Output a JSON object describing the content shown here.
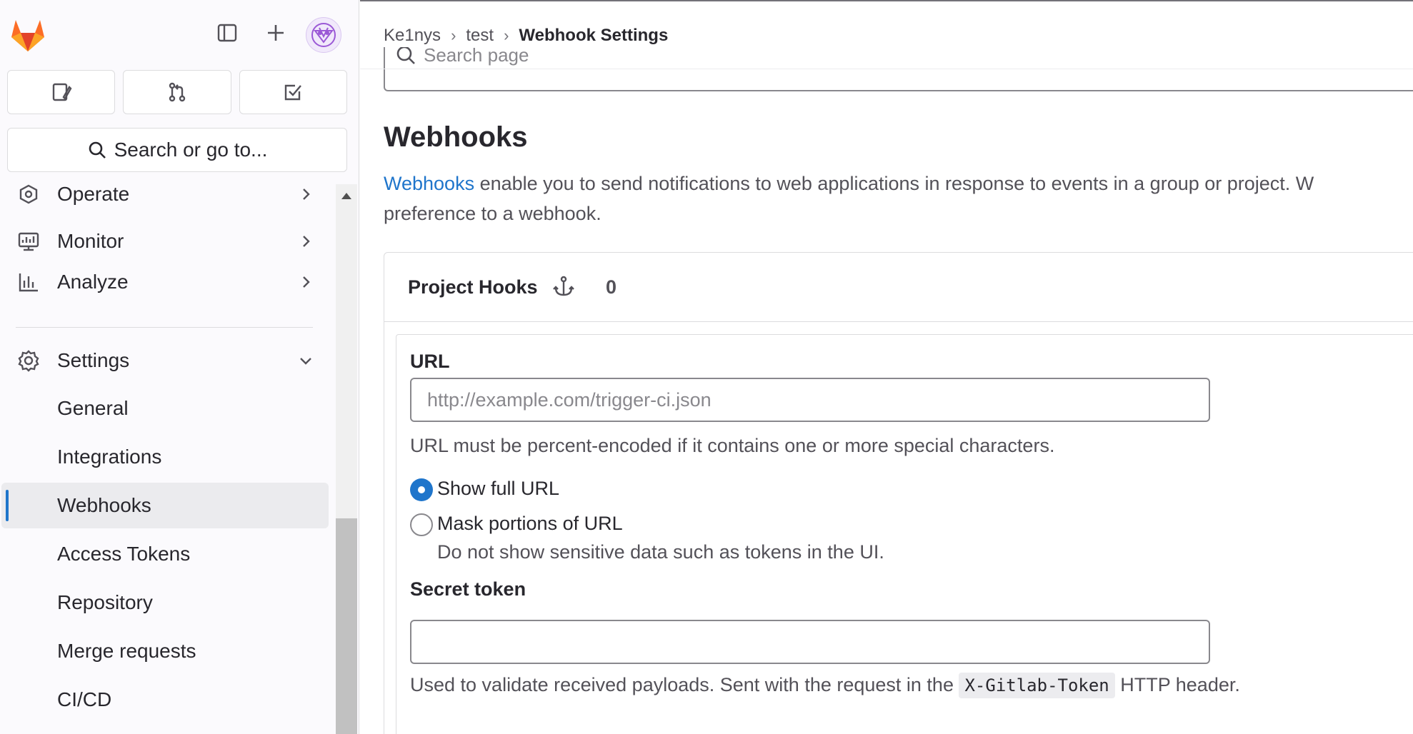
{
  "sidebar": {
    "search_label": "Search or go to...",
    "nav": [
      {
        "label": "Operate"
      },
      {
        "label": "Monitor"
      },
      {
        "label": "Analyze"
      },
      {
        "label": "Settings"
      }
    ],
    "settings_items": [
      {
        "label": "General"
      },
      {
        "label": "Integrations"
      },
      {
        "label": "Webhooks"
      },
      {
        "label": "Access Tokens"
      },
      {
        "label": "Repository"
      },
      {
        "label": "Merge requests"
      },
      {
        "label": "CI/CD"
      }
    ]
  },
  "breadcrumb": {
    "items": [
      "Ke1nys",
      "test",
      "Webhook Settings"
    ]
  },
  "page_search": {
    "placeholder": "Search page"
  },
  "page": {
    "title": "Webhooks",
    "desc_link": "Webhooks",
    "desc_line1": " enable you to send notifications to web applications in response to events in a group or project. W",
    "desc_line2": "preference to a webhook."
  },
  "hooks_card": {
    "title": "Project Hooks",
    "count": "0"
  },
  "form": {
    "url_label": "URL",
    "url_placeholder": "http://example.com/trigger-ci.json",
    "url_help": "URL must be percent-encoded if it contains one or more special characters.",
    "radio_full": "Show full URL",
    "radio_mask": "Mask portions of URL",
    "radio_mask_help": "Do not show sensitive data such as tokens in the UI.",
    "secret_label": "Secret token",
    "secret_help_pre": "Used to validate received payloads. Sent with the request in the ",
    "secret_help_code": "X-Gitlab-Token",
    "secret_help_post": " HTTP header."
  },
  "colors": {
    "accent": "#1f75cb",
    "logo_orange": "#e24329",
    "logo_light": "#fca326"
  }
}
